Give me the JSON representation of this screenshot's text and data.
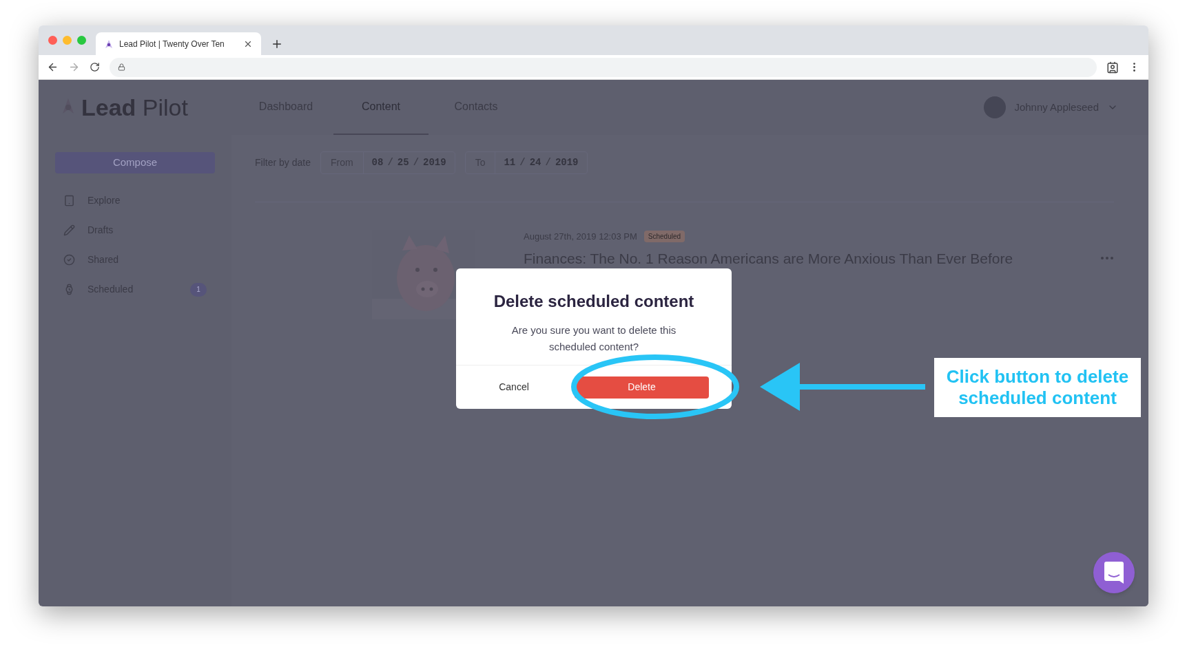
{
  "browser": {
    "tab_title": "Lead Pilot | Twenty Over Ten"
  },
  "app": {
    "logo": {
      "bold": "Lead",
      "light": "Pilot"
    },
    "nav": [
      {
        "label": "Dashboard",
        "selected": false
      },
      {
        "label": "Content",
        "selected": true
      },
      {
        "label": "Contacts",
        "selected": false
      }
    ],
    "user": {
      "name": "Johnny Appleseed"
    },
    "compose": "Compose",
    "filter": {
      "label": "Filter by date",
      "ranges": [
        {
          "label": "From",
          "parts": [
            "08",
            "/",
            "25",
            "/",
            "2019"
          ]
        },
        {
          "label": "To",
          "parts": [
            "11",
            "/",
            "24",
            "/",
            "2019"
          ]
        }
      ]
    },
    "sidebar": [
      {
        "label": "Explore"
      },
      {
        "label": "Drafts"
      },
      {
        "label": "Shared"
      },
      {
        "label": "Scheduled",
        "badge": "1"
      }
    ],
    "post": {
      "date": "August 27th, 2019 12:03 PM",
      "status": "Scheduled",
      "title": "Finances: The No. 1 Reason Americans are More Anxious Than Ever Before"
    }
  },
  "dialog": {
    "title": "Delete scheduled content",
    "message": "Are you sure you want to delete this scheduled content?",
    "cancel": "Cancel",
    "confirm": "Delete"
  },
  "annotation": {
    "text": "Click button to delete scheduled content"
  }
}
